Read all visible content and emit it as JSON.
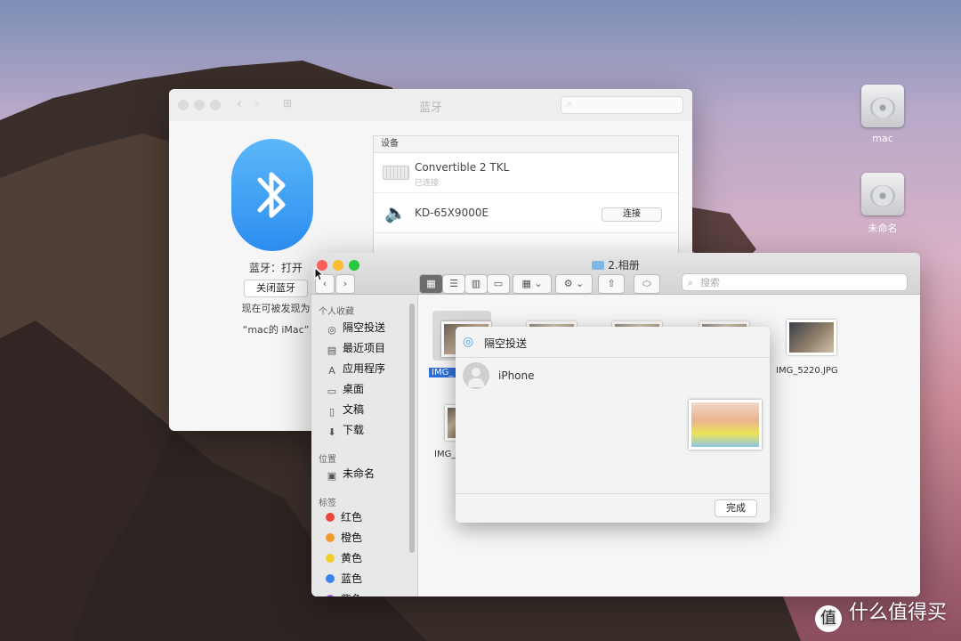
{
  "desktop": {
    "icons": [
      {
        "label": "mac",
        "icon": "hard-drive-icon"
      },
      {
        "label": "未命名",
        "icon": "hard-drive-icon"
      }
    ]
  },
  "bluetooth": {
    "title": "蓝牙",
    "status": "蓝牙：打开",
    "off_button": "关闭蓝牙",
    "discoverable_line1": "现在可被发现为",
    "discoverable_line2": "“mac的 iMac”",
    "devices_header": "设备",
    "devices": [
      {
        "name": "Convertible 2 TKL",
        "status": "已连接",
        "icon": "keyboard-icon"
      },
      {
        "name": "KD-65X9000E",
        "action": "连接",
        "icon": "speaker-icon"
      }
    ]
  },
  "finder": {
    "title": "2.相册",
    "search_placeholder": "搜索",
    "sidebar": {
      "favorites_header": "个人收藏",
      "favorites": [
        {
          "label": "隔空投送",
          "icon": "airdrop-icon"
        },
        {
          "label": "最近项目",
          "icon": "recents-icon"
        },
        {
          "label": "应用程序",
          "icon": "applications-icon"
        },
        {
          "label": "桌面",
          "icon": "desktop-icon"
        },
        {
          "label": "文稿",
          "icon": "documents-icon"
        },
        {
          "label": "下载",
          "icon": "downloads-icon"
        }
      ],
      "locations_header": "位置",
      "locations": [
        {
          "label": "未命名",
          "icon": "disk-icon"
        }
      ],
      "tags_header": "标签",
      "tags": [
        {
          "label": "红色",
          "color": "#e7463c"
        },
        {
          "label": "橙色",
          "color": "#f09a2f"
        },
        {
          "label": "黄色",
          "color": "#f3cf2c"
        },
        {
          "label": "蓝色",
          "color": "#3b83ec"
        },
        {
          "label": "紫色",
          "color": "#a05bd5"
        }
      ]
    },
    "files": [
      {
        "name": "IMG_"
      },
      {
        "name": "IMG_5220.JPG"
      },
      {
        "name": "IMG_"
      }
    ]
  },
  "airdrop_sheet": {
    "title": "隔空投送",
    "device": "iPhone",
    "done_button": "完成"
  },
  "watermark": {
    "badge": "值",
    "text": "什么值得买"
  }
}
